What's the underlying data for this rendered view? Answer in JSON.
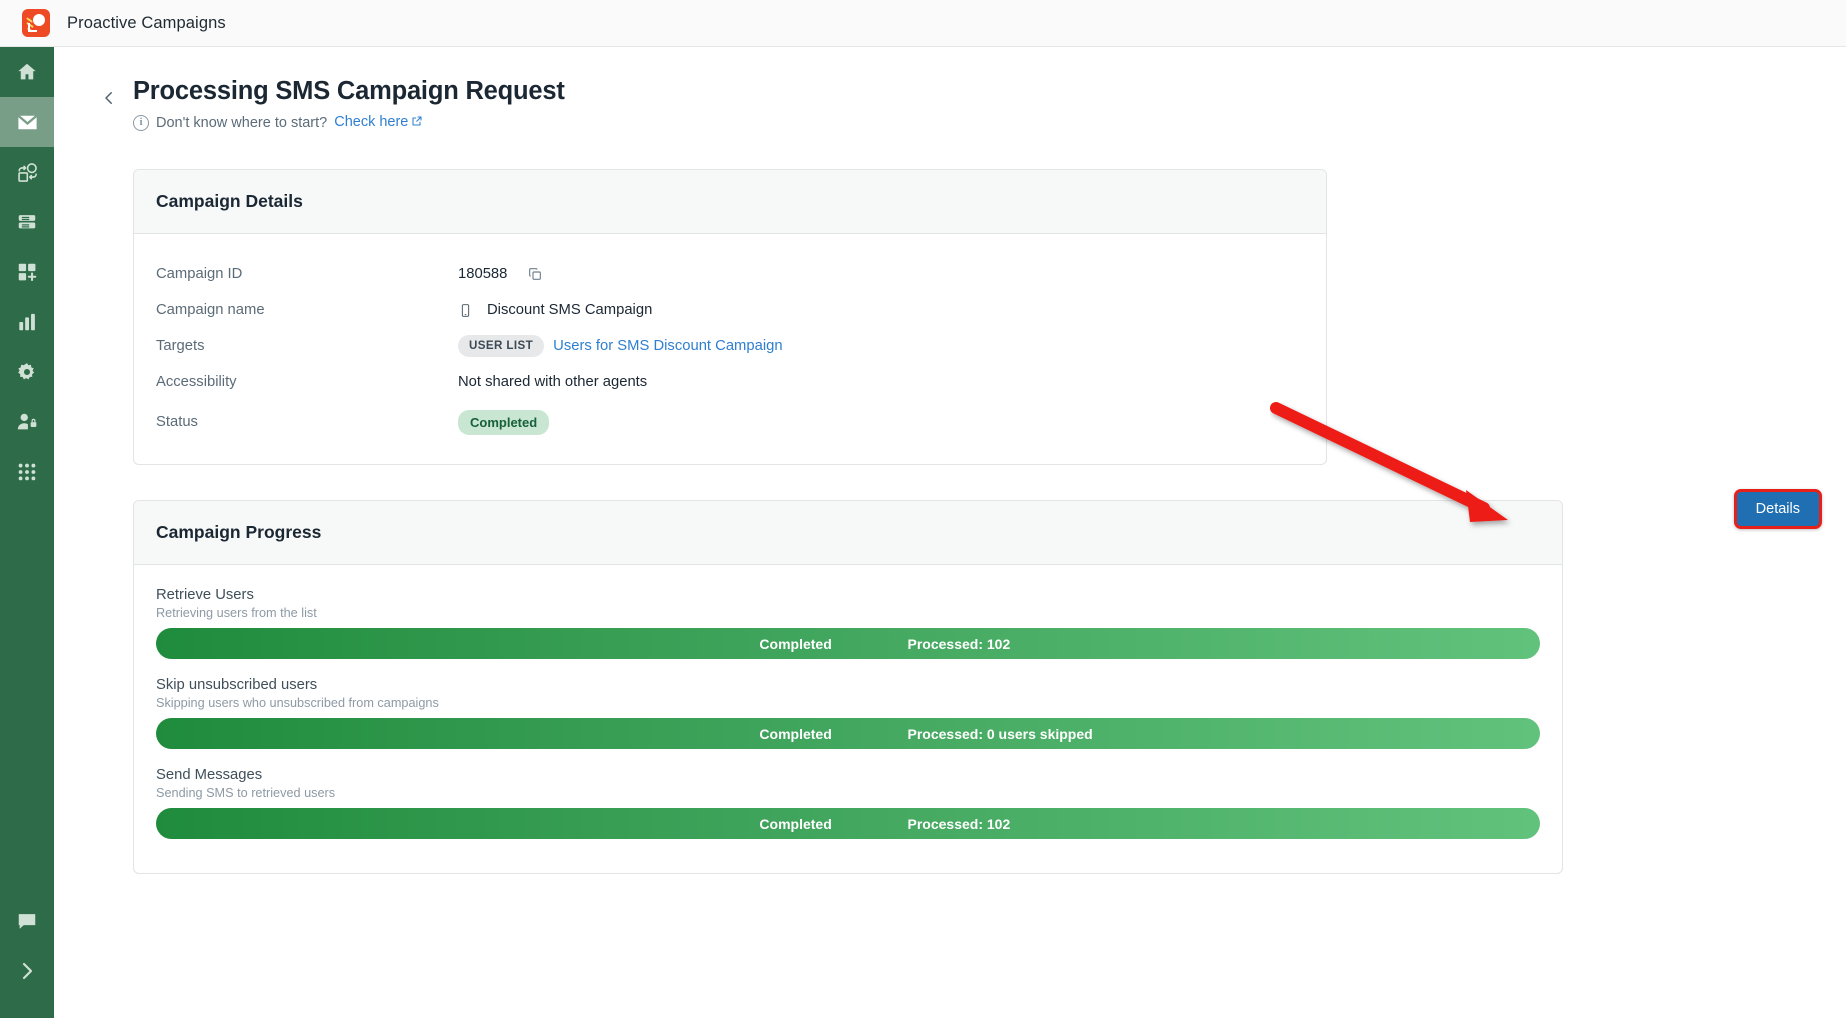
{
  "app": {
    "brand_title": "Proactive Campaigns",
    "logo_icon": "proactive-campaigns-logo"
  },
  "sidebar": {
    "items": [
      {
        "name": "home",
        "icon": "home-icon",
        "active": false
      },
      {
        "name": "campaigns",
        "icon": "envelope-icon",
        "active": true
      },
      {
        "name": "automation",
        "icon": "sync-shapes-icon",
        "active": false
      },
      {
        "name": "data",
        "icon": "database-icon",
        "active": false
      },
      {
        "name": "add-widget",
        "icon": "add-grid-icon",
        "active": false
      },
      {
        "name": "reports",
        "icon": "bar-chart-icon",
        "active": false
      },
      {
        "name": "settings",
        "icon": "gear-icon",
        "active": false
      },
      {
        "name": "permissions",
        "icon": "user-lock-icon",
        "active": false
      },
      {
        "name": "apps",
        "icon": "grid-dots-icon",
        "active": false
      }
    ],
    "bottom_items": [
      {
        "name": "feedback",
        "icon": "chat-bubble-icon"
      },
      {
        "name": "expand-sidebar",
        "icon": "chevron-right-icon"
      }
    ]
  },
  "header": {
    "back_icon": "chevron-left-icon",
    "title": "Processing SMS Campaign Request",
    "info_icon": "info-icon",
    "subtitle": "Don't know where to start?",
    "subtitle_link": "Check here",
    "external_link_icon": "external-link-icon"
  },
  "details_card": {
    "title": "Campaign Details",
    "rows": [
      {
        "label": "Campaign ID",
        "value": "180588",
        "icon": "copy-icon"
      },
      {
        "label": "Campaign name",
        "value": "Discount SMS Campaign",
        "icon": "mobile-phone-icon"
      },
      {
        "label": "Targets",
        "tag": "USER LIST",
        "link": "Users for SMS Discount Campaign"
      },
      {
        "label": "Accessibility",
        "value": "Not shared with other agents"
      },
      {
        "label": "Status",
        "badge": "Completed"
      }
    ]
  },
  "progress_card": {
    "title": "Campaign Progress",
    "details_button": "Details",
    "steps": [
      {
        "title": "Retrieve Users",
        "description": "Retrieving users from the list",
        "status": "Completed",
        "processed": "Processed: 102",
        "percent": 100
      },
      {
        "title": "Skip unsubscribed users",
        "description": "Skipping users who unsubscribed from campaigns",
        "status": "Completed",
        "processed": "Processed: 0 users skipped",
        "percent": 100
      },
      {
        "title": "Send Messages",
        "description": "Sending SMS to retrieved users",
        "status": "Completed",
        "processed": "Processed: 102",
        "percent": 100
      }
    ]
  },
  "annotation": {
    "arrow_color": "#ee1b18",
    "highlight_color": "#e8201a",
    "target": "details-button"
  },
  "colors": {
    "sidebar": "#2e6b48",
    "sidebar_active": "#789e88",
    "accent_blue": "#2f7fd1",
    "button_blue": "#1f6fb2",
    "progress_green_start": "#1f8b3c",
    "progress_green_end": "#61c27c",
    "status_badge_bg": "#c8e6d2",
    "status_badge_text": "#17603a"
  }
}
